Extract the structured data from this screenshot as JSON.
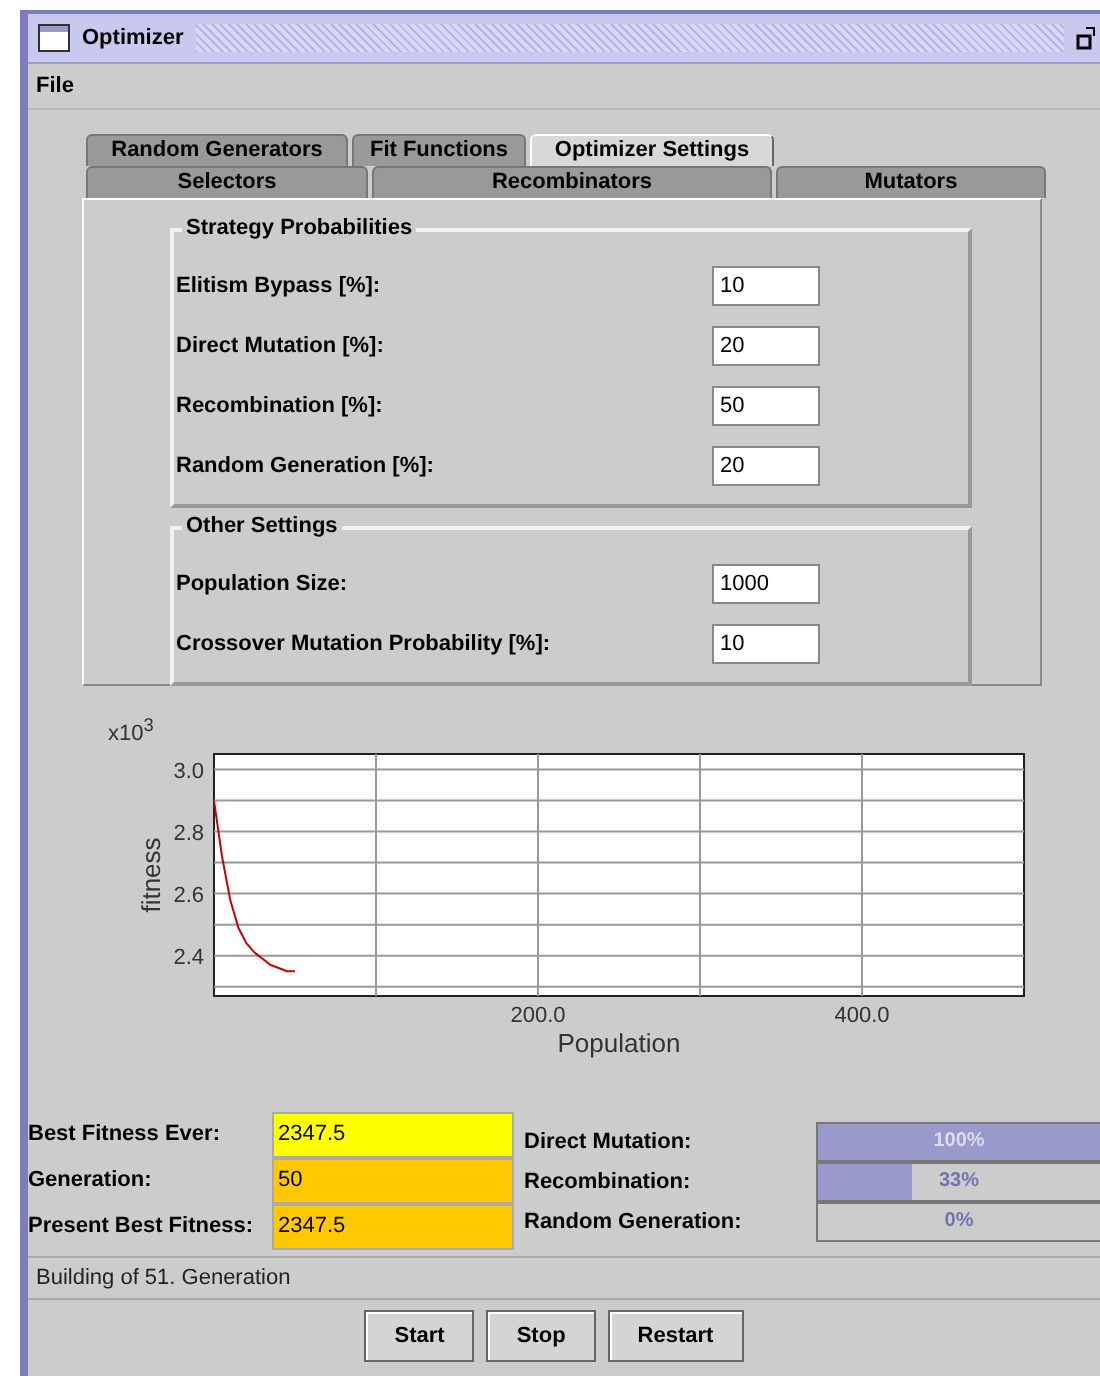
{
  "window": {
    "title": "Optimizer"
  },
  "menu": [
    "File"
  ],
  "tab_rows": [
    [
      {
        "label": "Random Generators",
        "selected": false
      },
      {
        "label": "Fit Functions",
        "selected": false
      },
      {
        "label": "Optimizer Settings",
        "selected": true
      }
    ],
    [
      {
        "label": "Selectors",
        "selected": false
      },
      {
        "label": "Recombinators",
        "selected": false
      },
      {
        "label": "Mutators",
        "selected": false
      }
    ]
  ],
  "groups": [
    {
      "title": "Strategy Probabilities",
      "fields": [
        {
          "label": "Elitism Bypass [%]:",
          "value": "10"
        },
        {
          "label": "Direct Mutation [%]:",
          "value": "20"
        },
        {
          "label": "Recombination [%]:",
          "value": "50"
        },
        {
          "label": "Random Generation [%]:",
          "value": "20"
        }
      ]
    },
    {
      "title": "Other Settings",
      "fields": [
        {
          "label": "Population Size:",
          "value": "1000"
        },
        {
          "label": "Crossover Mutation Probability [%]:",
          "value": "10"
        }
      ]
    }
  ],
  "chart": {
    "scale_label": "x10$^{3}$",
    "chart_data": {
      "type": "line",
      "xlabel": "Population",
      "ylabel": "fitness",
      "xlim": [
        0,
        500
      ],
      "ylim": [
        2.27,
        3.05
      ],
      "grid": true,
      "xticks": [
        {
          "value": 200,
          "label": "200.0"
        },
        {
          "value": 400,
          "label": "400.0"
        }
      ],
      "yticks": [
        2.4,
        2.6,
        2.8,
        {
          "value": 3.0,
          "label": "3.0"
        }
      ],
      "x": [
        0,
        5,
        10,
        15,
        20,
        25,
        30,
        35,
        40,
        45,
        50
      ],
      "series": [
        {
          "color": "#cc0000",
          "values": [
            2.9,
            2.72,
            2.58,
            2.49,
            2.44,
            2.41,
            2.39,
            2.37,
            2.36,
            2.35,
            2.35
          ]
        }
      ]
    }
  },
  "stats": [
    {
      "label": "Best Fitness Ever:",
      "value": "2347.5",
      "color": "#ffff00"
    },
    {
      "label": "Generation:",
      "value": "50",
      "color": "#ffc800"
    },
    {
      "label": "Present Best Fitness:",
      "value": "2347.5",
      "color": "#ffc800"
    }
  ],
  "progress": [
    {
      "label": "Direct Mutation:",
      "level": 1.0,
      "reading": "100%"
    },
    {
      "label": "Recombination:",
      "level": 0.33,
      "reading": "33%"
    },
    {
      "label": "Random Generation:",
      "reading": "0%"
    }
  ],
  "status": "Building of 51. Generation",
  "buttons": [
    "Start",
    "Stop",
    "Restart"
  ]
}
